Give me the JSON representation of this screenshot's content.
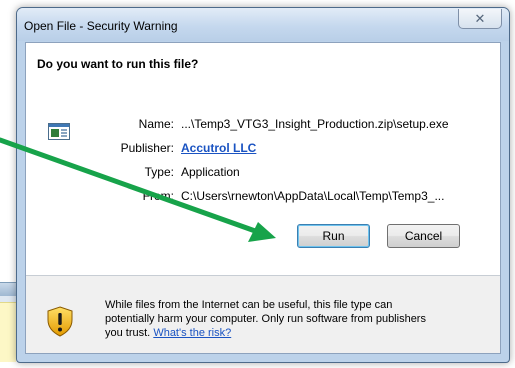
{
  "window": {
    "title": "Open File - Security Warning",
    "close_glyph": "✕"
  },
  "dialog": {
    "question": "Do you want to run this file?",
    "file_icon": "application-window-icon",
    "fields": [
      {
        "label": "Name:",
        "value": "...\\Temp3_VTG3_Insight_Production.zip\\setup.exe"
      },
      {
        "label": "Publisher:",
        "value": "Accutrol LLC"
      },
      {
        "label": "Type:",
        "value": "Application"
      },
      {
        "label": "From:",
        "value": "C:\\Users\\rnewton\\AppData\\Local\\Temp\\Temp3_..."
      }
    ]
  },
  "buttons": {
    "run_label": "Run",
    "cancel_label": "Cancel"
  },
  "footer": {
    "shield_icon": "shield-warning-icon",
    "warning_text": "While files from the Internet can be useful, this file type can potentially harm your computer. Only run software from publishers you trust.",
    "risk_link": "What's the risk?"
  },
  "annotation": {
    "arrow_color": "#17a34a"
  },
  "colors": {
    "title_bar": "#c5d8ee",
    "link": "#1a53c2",
    "footer_bg": "#f0f0f0"
  }
}
